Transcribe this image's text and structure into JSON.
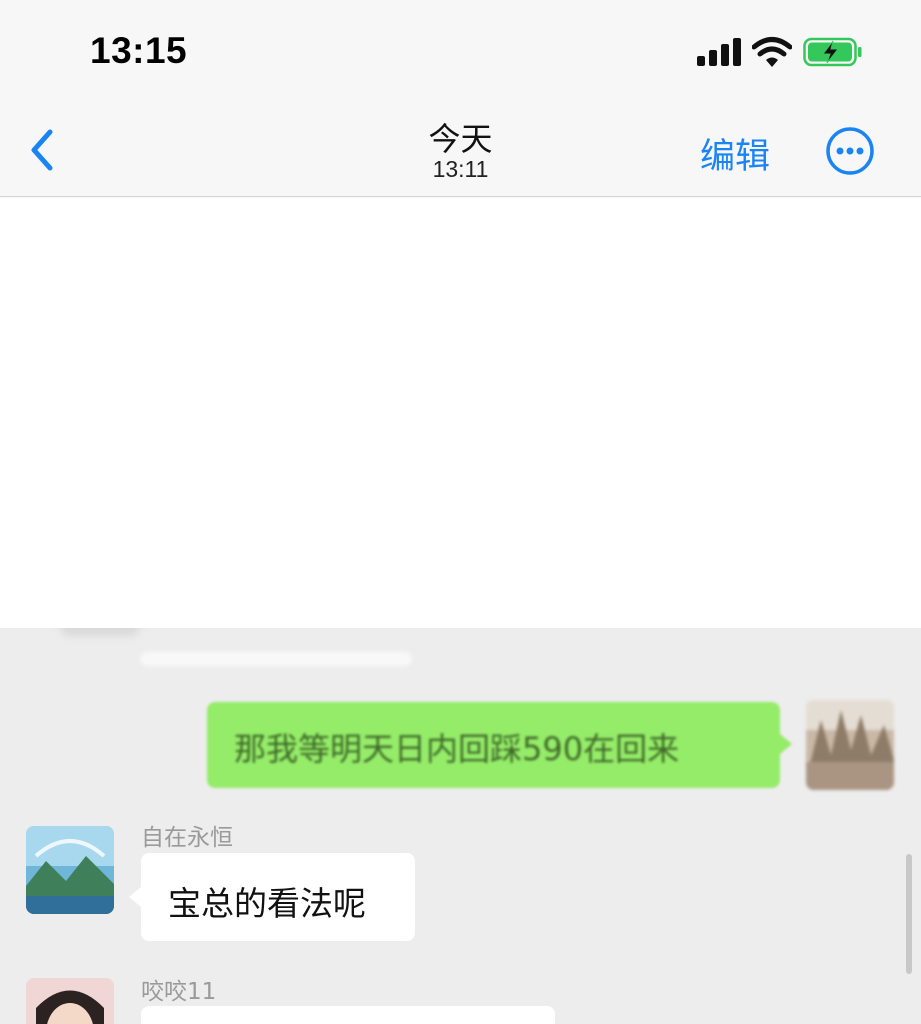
{
  "status_bar": {
    "time": "13:15",
    "signal_icon": "cellular-signal-icon",
    "wifi_icon": "wifi-icon",
    "battery_icon": "battery-charging-icon",
    "battery_color": "#34c759"
  },
  "nav_bar": {
    "back_icon": "chevron-left-icon",
    "title": "今天",
    "subtitle": "13:11",
    "edit_label": "编辑",
    "more_icon": "more-circle-icon",
    "accent_color": "#1a84f5"
  },
  "chat": {
    "messages": [
      {
        "direction": "outgoing",
        "text": "那我等明天日内回踩590在回来",
        "bubble_color": "#95ec69"
      },
      {
        "direction": "incoming",
        "sender": "自在永恒",
        "text": "宝总的看法呢",
        "bubble_color": "#ffffff"
      },
      {
        "direction": "incoming",
        "sender": "咬咬11",
        "text": "",
        "bubble_color": "#ffffff"
      }
    ]
  }
}
